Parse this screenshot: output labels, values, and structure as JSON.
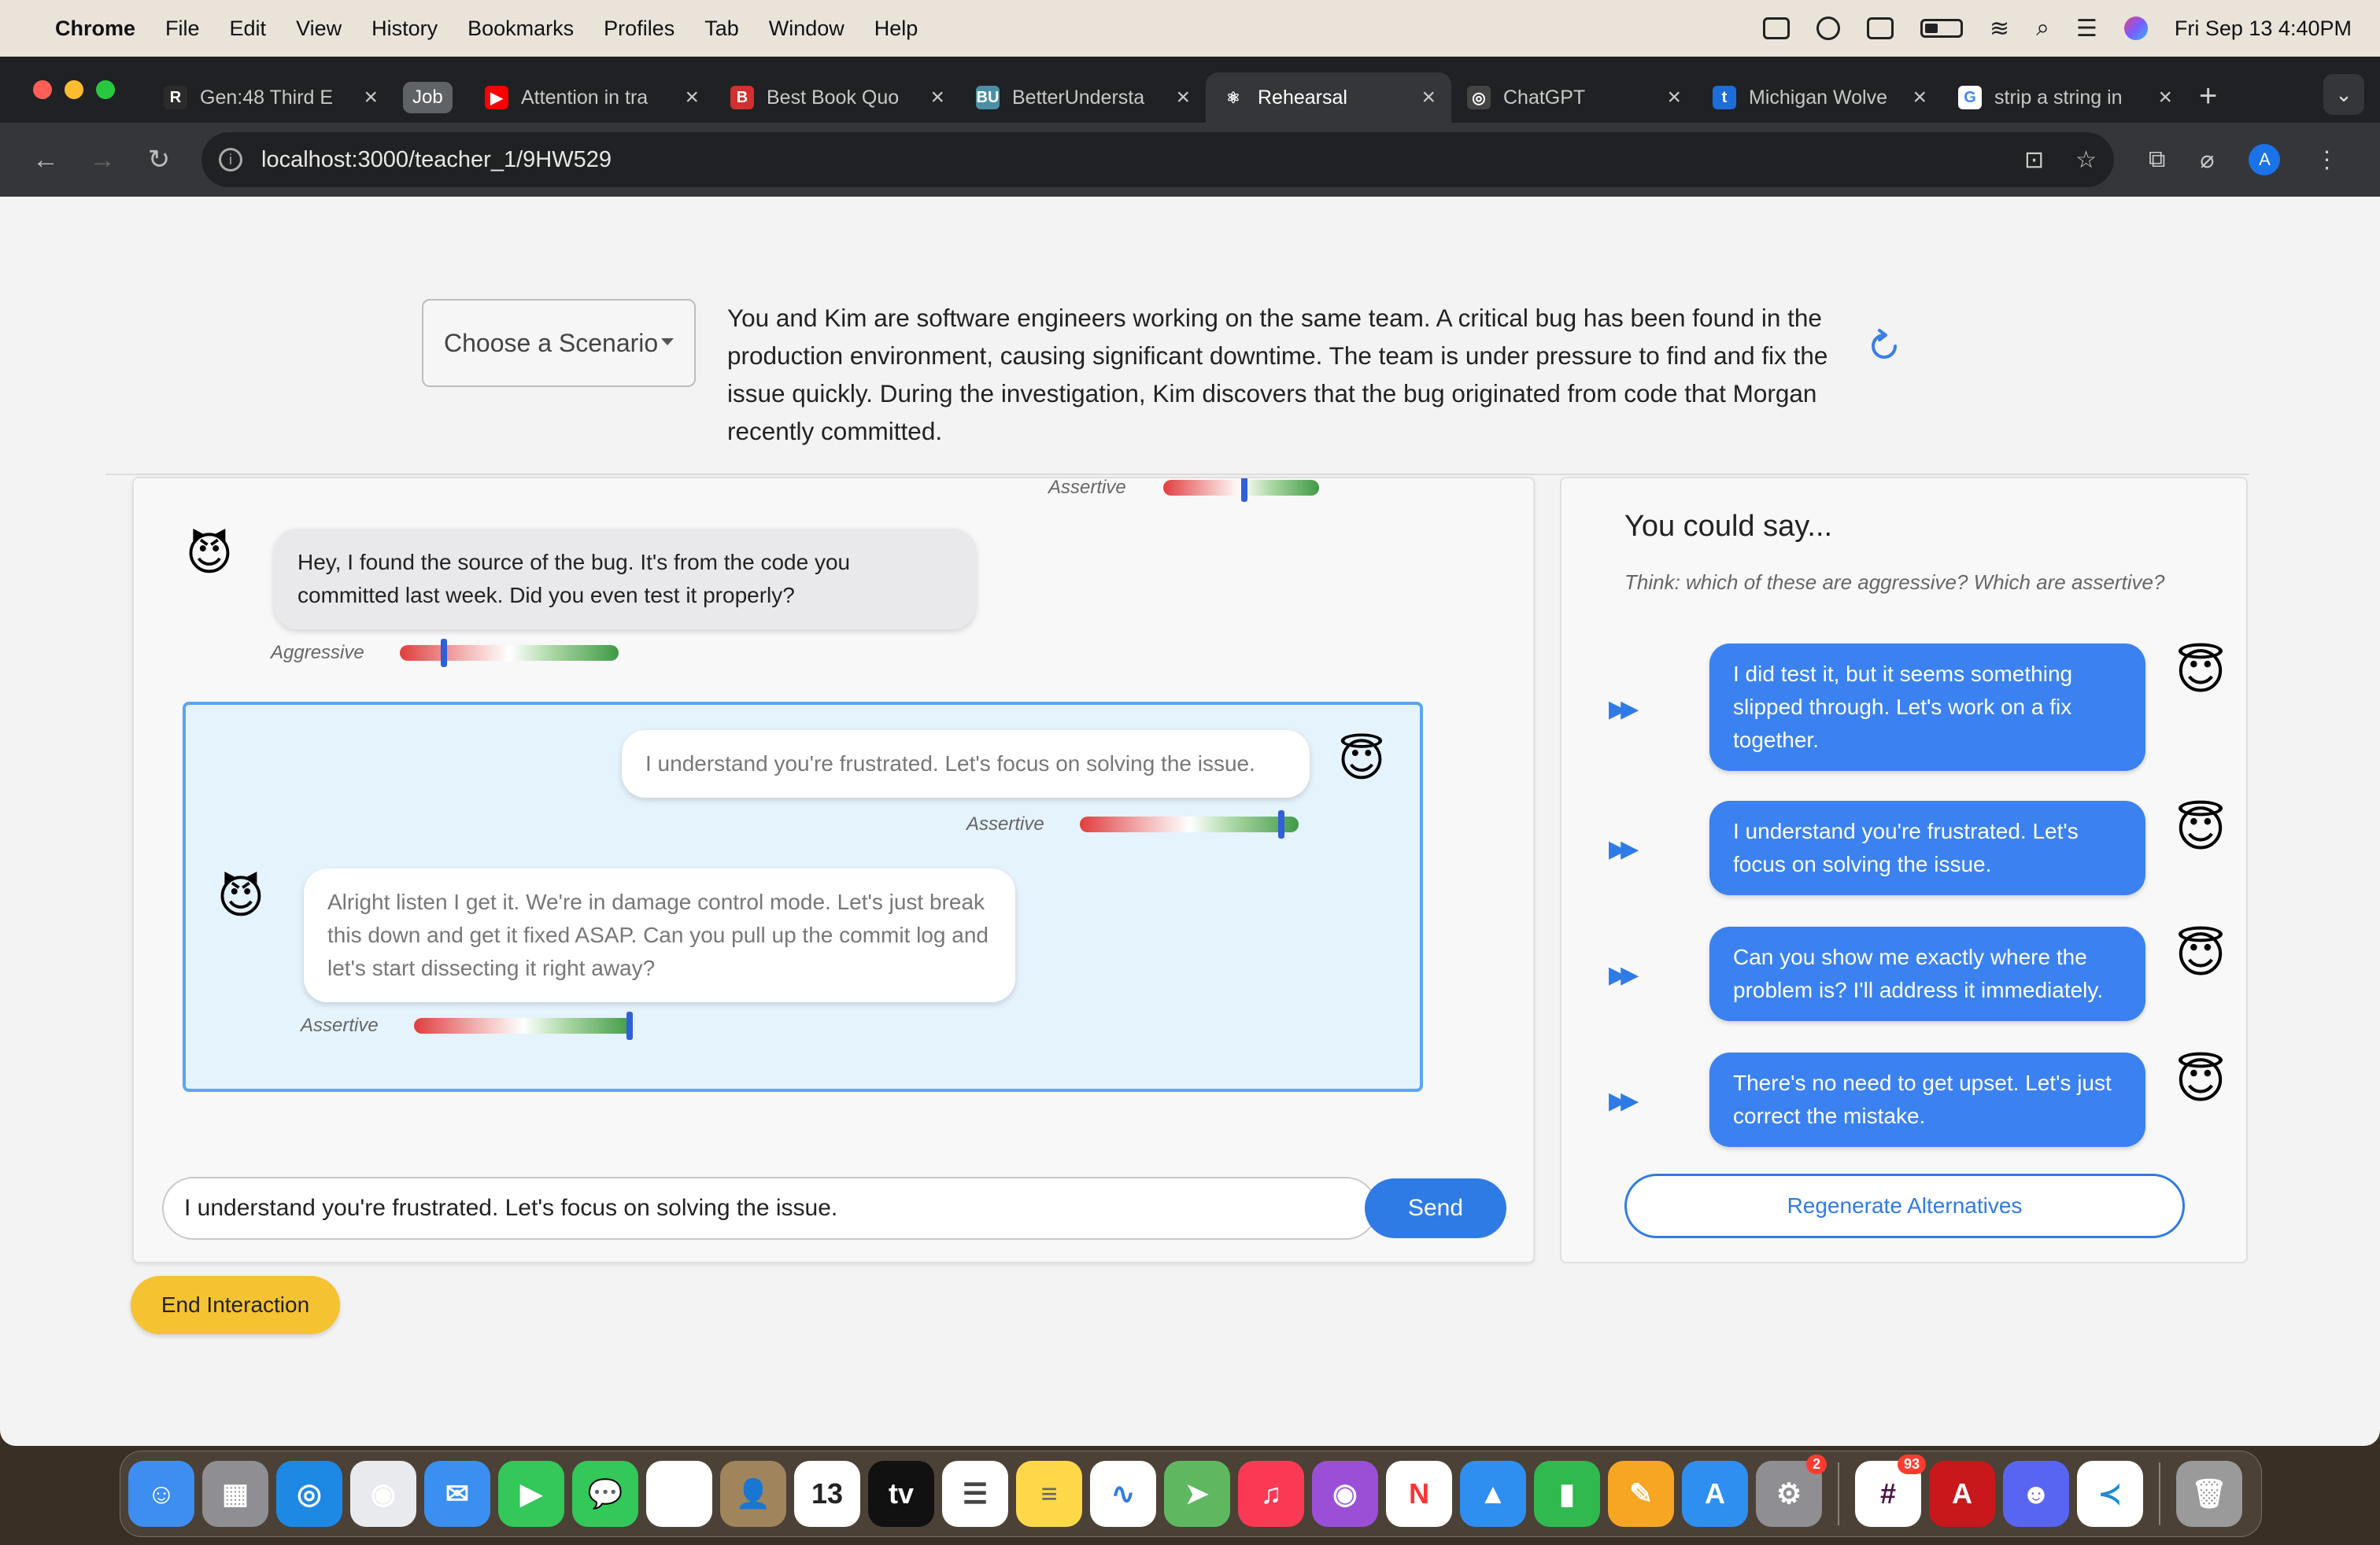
{
  "menubar": {
    "app_name": "Chrome",
    "items": [
      "File",
      "Edit",
      "View",
      "History",
      "Bookmarks",
      "Profiles",
      "Tab",
      "Window",
      "Help"
    ],
    "datetime": "Fri Sep 13  4:40PM"
  },
  "tabs": [
    {
      "title": "Gen:48 Third E",
      "favicon": "R",
      "color": "#2b2b2b"
    },
    {
      "title": "Job",
      "pill": true
    },
    {
      "title": "Attention in tra",
      "favicon": "▶",
      "color": "#ff0000"
    },
    {
      "title": "Best Book Quo",
      "favicon": "B",
      "color": "#d32f2f"
    },
    {
      "title": "BetterUndersta",
      "favicon": "BU",
      "color": "#4a90a4"
    },
    {
      "title": "Rehearsal",
      "favicon": "⚛",
      "color": "#35363a",
      "active": true
    },
    {
      "title": "ChatGPT",
      "favicon": "◎",
      "color": "#444"
    },
    {
      "title": "Michigan Wolve",
      "favicon": "t",
      "color": "#1d6ed8"
    },
    {
      "title": "strip a string in",
      "favicon": "G",
      "color": "#ffffff"
    }
  ],
  "address_bar": {
    "url": "localhost:3000/teacher_1/9HW529"
  },
  "scenario": {
    "select_placeholder": "Choose a Scenario",
    "description": "You and Kim are software engineers working on the same team. A critical bug has been found in the production environment, causing significant downtime. The team is under pressure to find and fix the issue quickly. During the investigation, Kim discovers that the bug originated from code that Morgan recently committed."
  },
  "chat": {
    "top_tone": {
      "label": "Assertive",
      "level": 0.52
    },
    "messages": [
      {
        "avatar": "😈",
        "text": "Hey, I found the source of the bug. It's from the code you committed last week. Did you even test it properly?",
        "tone_label": "Aggressive",
        "tone_level": 0.2
      }
    ],
    "highlighted": [
      {
        "avatar": "😇",
        "text": "I understand you're frustrated. Let's focus on solving the issue.",
        "tone_label": "Assertive",
        "tone_level": 0.92
      },
      {
        "avatar": "😈",
        "text": "Alright listen I get it. We're in damage control mode. Let's just break this down and get it fixed ASAP. Can you pull up the commit log and let's start dissecting it right away?",
        "tone_label": "Assertive",
        "tone_level": 1.0
      }
    ],
    "input_value": "I understand you're frustrated. Let's focus on solving the issue.",
    "send_label": "Send"
  },
  "end_button_label": "End Interaction",
  "suggestions": {
    "title": "You could say...",
    "hint": "Think: which of these are aggressive? Which are assertive?",
    "items": [
      {
        "text": "I did test it, but it seems something slipped through. Let's work on a fix together.",
        "emoji": "😇"
      },
      {
        "text": "I understand you're frustrated. Let's focus on solving the issue.",
        "emoji": "😇"
      },
      {
        "text": "Can you show me exactly where the problem is? I'll address it immediately.",
        "emoji": "😇"
      },
      {
        "text": "There's no need to get upset. Let's just correct the mistake.",
        "emoji": "😇"
      }
    ],
    "regenerate_label": "Regenerate Alternatives"
  },
  "dock": {
    "apps": [
      {
        "name": "finder-icon",
        "color": "#3d8ef0",
        "glyph": "☺"
      },
      {
        "name": "launchpad-icon",
        "color": "#8e8e93",
        "glyph": "▦"
      },
      {
        "name": "safari-icon",
        "color": "#1e88e5",
        "glyph": "◎"
      },
      {
        "name": "chrome-icon",
        "color": "#e8eaed",
        "glyph": "◉"
      },
      {
        "name": "mail-icon",
        "color": "#3a8ff0",
        "glyph": "✉"
      },
      {
        "name": "facetime-icon",
        "color": "#34c759",
        "glyph": "▶"
      },
      {
        "name": "messages-icon",
        "color": "#34c759",
        "glyph": "💬"
      },
      {
        "name": "photos-icon",
        "color": "#ffffff",
        "glyph": "✿"
      },
      {
        "name": "contacts-icon",
        "color": "#a0845c",
        "glyph": "👤"
      },
      {
        "name": "calendar-icon",
        "color": "#ffffff",
        "glyph": "13",
        "text_color": "#222"
      },
      {
        "name": "tv-icon",
        "color": "#111111",
        "glyph": "tv"
      },
      {
        "name": "reminders-icon",
        "color": "#ffffff",
        "glyph": "☰",
        "text_color": "#444"
      },
      {
        "name": "notes-icon",
        "color": "#ffd84a",
        "glyph": "≡",
        "text_color": "#666"
      },
      {
        "name": "freeform-icon",
        "color": "#ffffff",
        "glyph": "∿",
        "text_color": "#2f7be6"
      },
      {
        "name": "maps-icon",
        "color": "#5fb85f",
        "glyph": "➤"
      },
      {
        "name": "music-icon",
        "color": "#fa3a55",
        "glyph": "♫"
      },
      {
        "name": "podcasts-icon",
        "color": "#9b4fd6",
        "glyph": "◉"
      },
      {
        "name": "news-icon",
        "color": "#ffffff",
        "glyph": "N",
        "text_color": "#f33"
      },
      {
        "name": "keynote-icon",
        "color": "#2f8ff0",
        "glyph": "▲"
      },
      {
        "name": "numbers-icon",
        "color": "#30b94e",
        "glyph": "▮"
      },
      {
        "name": "pages-icon",
        "color": "#f6a623",
        "glyph": "✎"
      },
      {
        "name": "app-store-icon",
        "color": "#2f8ff0",
        "glyph": "A"
      },
      {
        "name": "system-settings-icon",
        "color": "#8e8e93",
        "glyph": "⚙",
        "badge": "2"
      },
      {
        "sep": true
      },
      {
        "name": "slack-icon",
        "color": "#ffffff",
        "glyph": "#",
        "text_color": "#4a154b",
        "badge": "93"
      },
      {
        "name": "acrobat-icon",
        "color": "#c8181b",
        "glyph": "A"
      },
      {
        "name": "discord-icon",
        "color": "#5865f2",
        "glyph": "☻"
      },
      {
        "name": "vscode-icon",
        "color": "#ffffff",
        "glyph": "≺",
        "text_color": "#1f8ad2"
      },
      {
        "sep": true
      },
      {
        "name": "trash-icon",
        "color": "#9a9a9a",
        "glyph": "🗑"
      }
    ]
  }
}
